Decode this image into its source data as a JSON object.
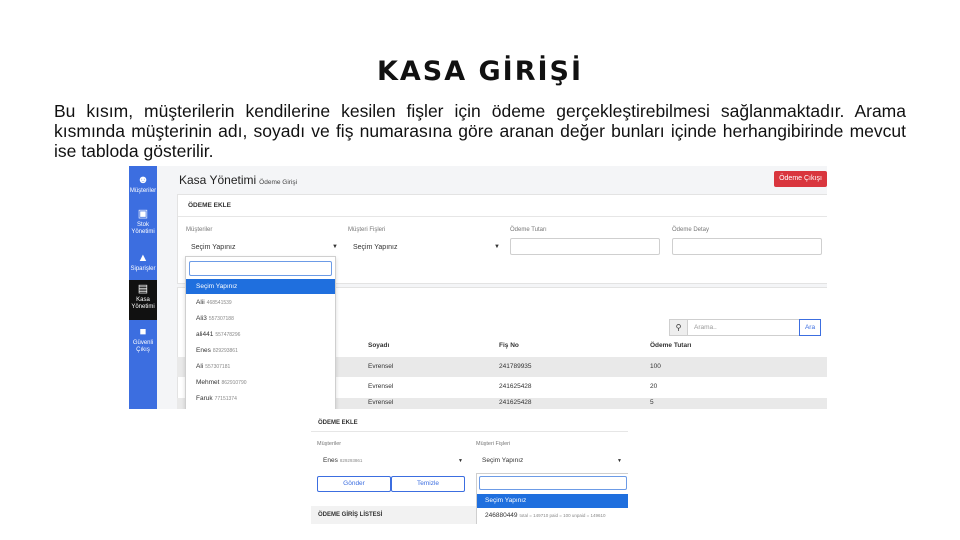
{
  "slide": {
    "title": "KASA GİRİŞİ",
    "description": "Bu kısım, müşterilerin kendilerine kesilen fişler için ödeme gerçekleştirebilmesi sağlanmaktadır. Arama kısmında müşterinin adı, soyadı ve fiş numarasına göre aranan değer bunları içinde herhangibirinde mevcut ise tabloda gösterilir."
  },
  "sidebar": {
    "items": [
      {
        "icon": "user-icon",
        "label": "Müşteriler"
      },
      {
        "icon": "basket-icon",
        "label": "Stok Yönetimi"
      },
      {
        "icon": "cart-icon",
        "label": "Siparişler"
      },
      {
        "icon": "cash-register-icon",
        "label": "Kasa Yönetimi",
        "active": true
      },
      {
        "icon": "lock-icon",
        "label": "Güvenli Çıkış"
      }
    ]
  },
  "header": {
    "title": "Kasa Yönetimi",
    "subtitle": "Ödeme Girişi",
    "exit_button": "Ödeme Çıkışı"
  },
  "form": {
    "section_title": "ÖDEME EKLE",
    "customer_label": "Müşteriler",
    "customer_value": "Seçim Yapınız",
    "receipt_label": "Müşteri Fişleri",
    "receipt_value": "Seçim Yapınız",
    "amount_label": "Ödeme Tutarı",
    "detail_label": "Ödeme Detay"
  },
  "dropdown": {
    "options": [
      {
        "name": "Seçim Yapınız",
        "num": "",
        "selected": true
      },
      {
        "name": "Alii",
        "num": "468541539"
      },
      {
        "name": "Ali3",
        "num": "557307188"
      },
      {
        "name": "ali441",
        "num": "557478296"
      },
      {
        "name": "Enes",
        "num": "829293861"
      },
      {
        "name": "Ali",
        "num": "557307181"
      },
      {
        "name": "Mehmet",
        "num": "862910790"
      },
      {
        "name": "Faruk",
        "num": "77151374"
      }
    ]
  },
  "search": {
    "placeholder": "Arama..",
    "button": "Ara"
  },
  "table": {
    "headers": [
      "Soyadı",
      "Fiş No",
      "Ödeme Tutarı"
    ],
    "rows": [
      {
        "surname": "Evrensel",
        "receipt": "241789935",
        "amount": "100"
      },
      {
        "surname": "Evrensel",
        "receipt": "241625428",
        "amount": "20"
      },
      {
        "surname": "Evrensel",
        "receipt": "241625428",
        "amount": "5"
      }
    ]
  },
  "detail_panel": {
    "section_title": "ÖDEME EKLE",
    "customer_label": "Müşteriler",
    "customer_value": "Enes",
    "customer_num": "829293861",
    "receipt_label": "Müşteri Fişleri",
    "receipt_value": "Seçim Yapınız",
    "send_button": "Gönder",
    "clear_button": "Temizle",
    "list_title": "ÖDEME GİRİŞ LİSTESİ",
    "receipt_options": [
      {
        "text": "Seçim Yapınız",
        "detail": "",
        "selected": true
      },
      {
        "text": "246880449",
        "detail": "total = 149710 paid = 100 unpaid = 149610"
      }
    ]
  },
  "colors": {
    "sidebar": "#3c6ee0",
    "danger": "#d9363e",
    "selected": "#1f6fde"
  }
}
